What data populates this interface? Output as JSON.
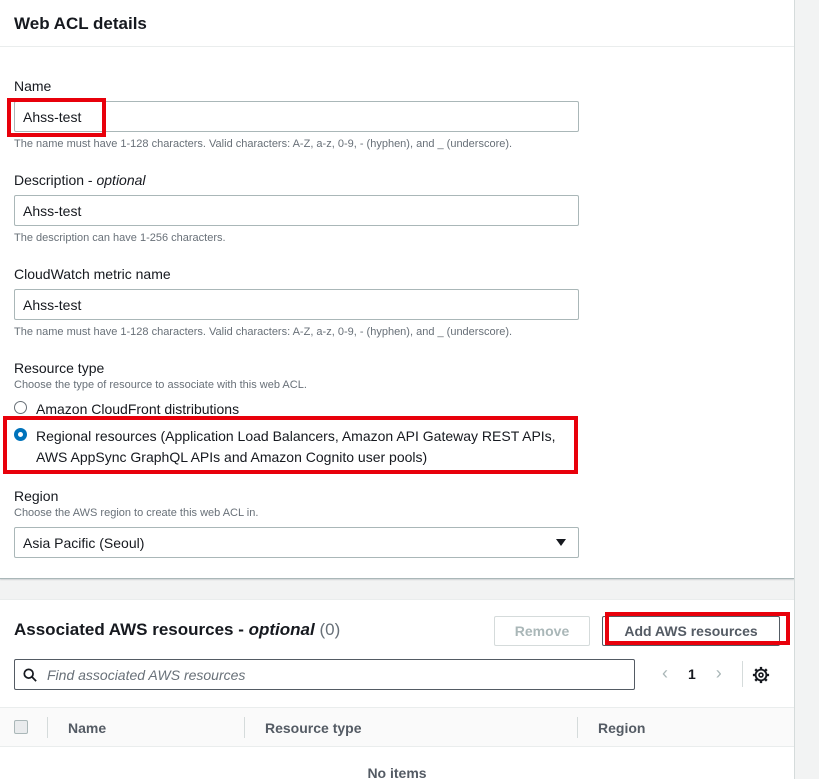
{
  "details": {
    "title": "Web ACL details",
    "name": {
      "label": "Name",
      "value": "Ahss-test",
      "hint": "The name must have 1-128 characters. Valid characters: A-Z, a-z, 0-9, - (hyphen), and _ (underscore)."
    },
    "description": {
      "label": "Description",
      "optional": "optional",
      "value": "Ahss-test",
      "hint": "The description can have 1-256 characters."
    },
    "metric": {
      "label": "CloudWatch metric name",
      "value": "Ahss-test",
      "hint": "The name must have 1-128 characters. Valid characters: A-Z, a-z, 0-9, - (hyphen), and _ (underscore)."
    },
    "resource_type": {
      "label": "Resource type",
      "hint": "Choose the type of resource to associate with this web ACL.",
      "options": [
        {
          "label": "Amazon CloudFront distributions",
          "selected": false
        },
        {
          "label_line1": "Regional resources (Application Load Balancers, Amazon API Gateway REST APIs,",
          "label_line2": "AWS AppSync GraphQL APIs and Amazon Cognito user pools)",
          "selected": true
        }
      ]
    },
    "region": {
      "label": "Region",
      "hint": "Choose the AWS region to create this web ACL in.",
      "value": "Asia Pacific (Seoul)"
    }
  },
  "resources": {
    "title": "Associated AWS resources - ",
    "optional": "optional",
    "count": "(0)",
    "remove_label": "Remove",
    "add_label": "Add AWS resources",
    "search_placeholder": "Find associated AWS resources",
    "page": "1",
    "columns": [
      "Name",
      "Resource type",
      "Region"
    ],
    "empty_text": "No items"
  },
  "colors": {
    "highlight": "#e8000b",
    "radio_selected": "#0073bb"
  },
  "icons": {
    "search": "search-icon",
    "settings": "gear-icon",
    "prev": "chevron-left-icon",
    "next": "chevron-right-icon",
    "dropdown": "caret-down-icon"
  }
}
